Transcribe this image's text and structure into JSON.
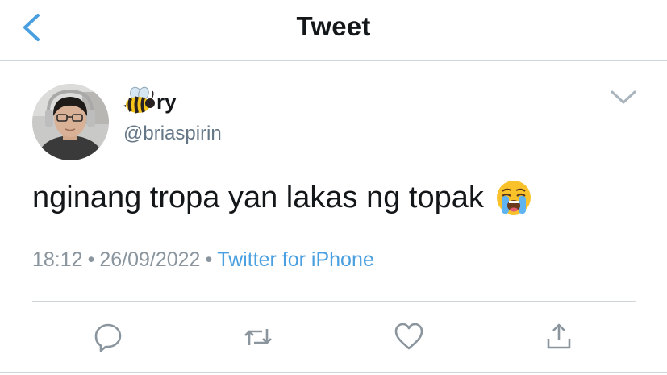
{
  "header": {
    "title": "Tweet"
  },
  "user": {
    "display_name": "ry",
    "display_name_emoji": "bee-emoji",
    "handle": "@briaspirin"
  },
  "tweet": {
    "text": "nginang tropa yan lakas ng topak",
    "emoji": "loudly-crying-face-emoji",
    "time": "18:12",
    "date": "26/09/2022",
    "separator": "•",
    "source": "Twitter for iPhone"
  },
  "actions": [
    "reply-icon",
    "retweet-icon",
    "like-icon",
    "share-icon"
  ],
  "colors": {
    "accent": "#4a9fe0",
    "text": "#14171a",
    "muted": "#657786",
    "divider": "#cfd5da"
  }
}
